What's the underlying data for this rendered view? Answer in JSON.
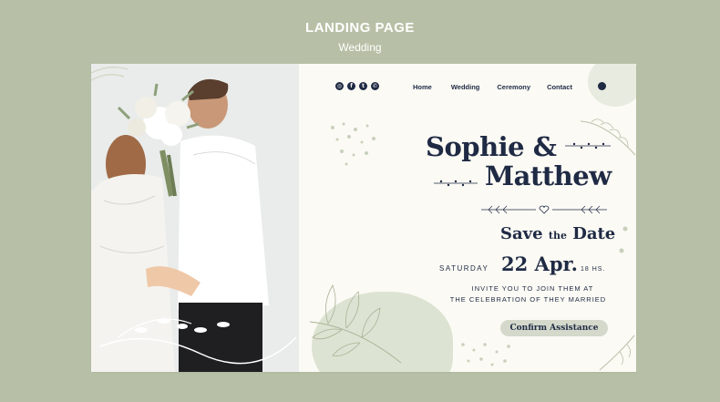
{
  "header": {
    "title": "LANDING PAGE",
    "subtitle": "Wedding"
  },
  "social": {
    "icons": [
      "instagram-icon",
      "facebook-icon",
      "twitter-icon",
      "whatsapp-icon"
    ]
  },
  "nav": {
    "home": "Home",
    "wedding": "Wedding",
    "ceremony": "Ceremony",
    "contact": "Contact"
  },
  "hero": {
    "name1": "Sophie &",
    "name2": "Matthew"
  },
  "event": {
    "save": "Save",
    "the": "the",
    "date_word": "Date",
    "weekday": "SATURDAY",
    "day_month": "22 Apr.",
    "hours": "18 HS."
  },
  "invite": {
    "line1": "INVITE YOU TO JOIN THEM AT",
    "line2": "THE CELEBRATION OF THEY MARRIED"
  },
  "cta": {
    "confirm": "Confirm Assistance"
  },
  "colors": {
    "page_bg": "#b7c0a6",
    "card_bg": "#fbfaf4",
    "ink": "#1f2a44",
    "sage": "#c9d1bd",
    "button": "#d4d9cb"
  }
}
